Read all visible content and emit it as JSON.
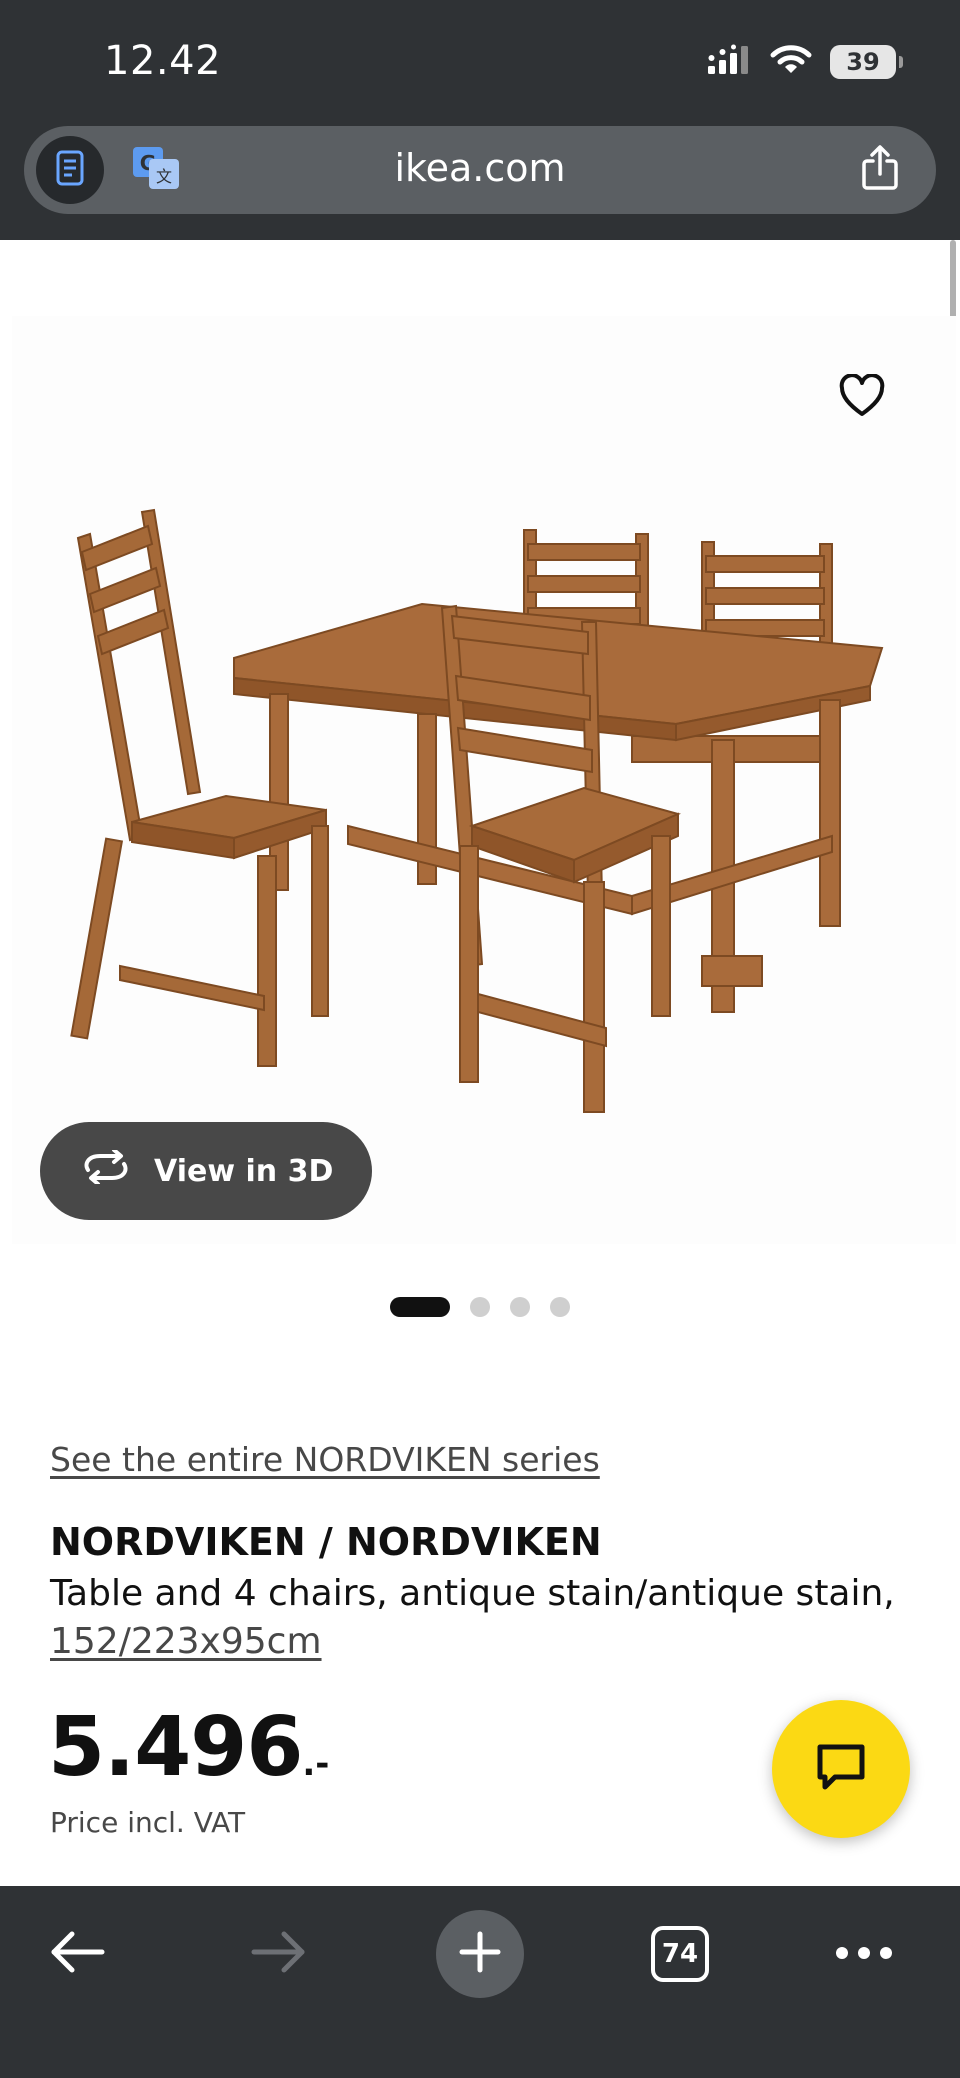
{
  "status_bar": {
    "time": "12.42",
    "battery_level": "39",
    "icons": [
      "cellular-signal-icon",
      "wifi-icon",
      "battery-icon"
    ]
  },
  "browser": {
    "url": "ikea.com",
    "buttons": [
      "reader-mode-icon",
      "translate-icon",
      "share-icon"
    ]
  },
  "product": {
    "image_alt": "NORDVIKEN table with 4 chairs",
    "view_3d_label": "View in 3D",
    "carousel": {
      "total": 4,
      "active": 1
    },
    "series_link": "See the entire NORDVIKEN series",
    "name": "NORDVIKEN / NORDVIKEN",
    "description": "Table and 4 chairs, antique stain/antique stain,",
    "dimensions": "152/223x95cm",
    "price_major": "5.496",
    "price_minor": ".-",
    "price_note": "Price incl. VAT"
  },
  "toolbar": {
    "tab_count": "74",
    "buttons": [
      "back-arrow-icon",
      "forward-arrow-icon",
      "new-tab-plus-icon",
      "tabs-icon",
      "more-icon"
    ]
  },
  "colors": {
    "chrome_bg": "#2f3235",
    "url_bar_bg": "#5b5f63",
    "chat_fab": "#fbd914",
    "view3d_bg": "#484848",
    "wood": "#a86a3a"
  }
}
